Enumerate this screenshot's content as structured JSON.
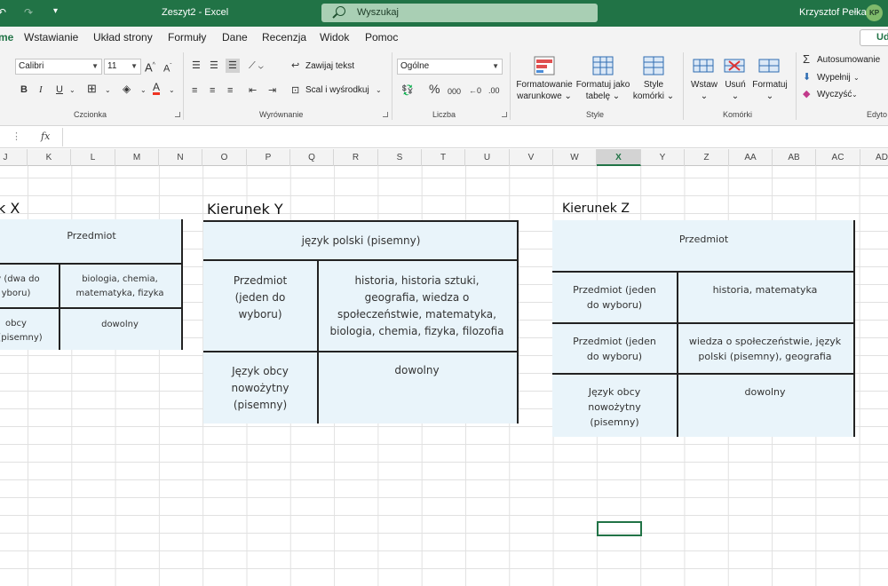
{
  "title_bar": {
    "doc_name": "Zeszyt2 - Excel",
    "search_placeholder": "Wyszukaj",
    "user_name": "Krzysztof Pełka",
    "avatar_initials": "KP",
    "accent": "#217346"
  },
  "menu": {
    "tabs": [
      "me",
      "Wstawianie",
      "Układ strony",
      "Formuły",
      "Dane",
      "Recenzja",
      "Widok",
      "Pomoc"
    ],
    "share_label": "Ud"
  },
  "ribbon": {
    "font": {
      "name": "Calibri",
      "size": "11",
      "group_label": "Czcionka"
    },
    "alignment": {
      "wrap_text": "Zawijaj tekst",
      "merge_center": "Scal i wyśrodkuj",
      "group_label": "Wyrównanie"
    },
    "number": {
      "format": "Ogólne",
      "group_label": "Liczba"
    },
    "styles": {
      "conditional_line1": "Formatowanie",
      "conditional_line2": "warunkowe",
      "table_line1": "Formatuj jako",
      "table_line2": "tabelę",
      "cell_styles_line1": "Style",
      "cell_styles_line2": "komórki",
      "group_label": "Style"
    },
    "cells": {
      "insert": "Wstaw",
      "delete": "Usuń",
      "format": "Formatuj",
      "group_label": "Komórki"
    },
    "editing": {
      "autosum": "Autosumowanie",
      "fill": "Wypełnij",
      "clear": "Wyczyść",
      "group_label": "Edyto"
    }
  },
  "formula_bar": {
    "fx": "fx"
  },
  "columns": [
    "J",
    "K",
    "L",
    "M",
    "N",
    "O",
    "P",
    "Q",
    "R",
    "S",
    "T",
    "U",
    "V",
    "W",
    "X",
    "Y",
    "Z",
    "AA",
    "AB",
    "AC",
    "AD"
  ],
  "selected_column": "X",
  "tables": {
    "x": {
      "title": "k X",
      "header": "Przedmiot",
      "row1_left": "ty (dwa do\nyboru)",
      "row1_right": "biologia, chemia,\nmatematyka, fizyka",
      "row2_left": "obcy\ny (pisemny)",
      "row2_right": "dowolny"
    },
    "y": {
      "title": "Kierunek Y",
      "header": "język polski (pisemny)",
      "row1_left": "Przedmiot\n(jeden do\nwyboru)",
      "row1_right": "historia, historia sztuki,\ngeografia, wiedza o\nspołeczeństwie, matematyka,\nbiologia, chemia, fizyka, filozofia",
      "row2_left": "Język obcy\nnowożytny\n(pisemny)",
      "row2_right": "dowolny"
    },
    "z": {
      "title": "Kierunek Z",
      "header": "Przedmiot",
      "row1_left": "Przedmiot (jeden\ndo wyboru)",
      "row1_right": "historia, matematyka",
      "row2_left": "Przedmiot (jeden\ndo wyboru)",
      "row2_right": "wiedza o społeczeństwie, język\npolski (pisemny), geografia",
      "row3_left": "Język obcy\nnowożytny\n(pisemny)",
      "row3_right": "dowolny"
    }
  }
}
